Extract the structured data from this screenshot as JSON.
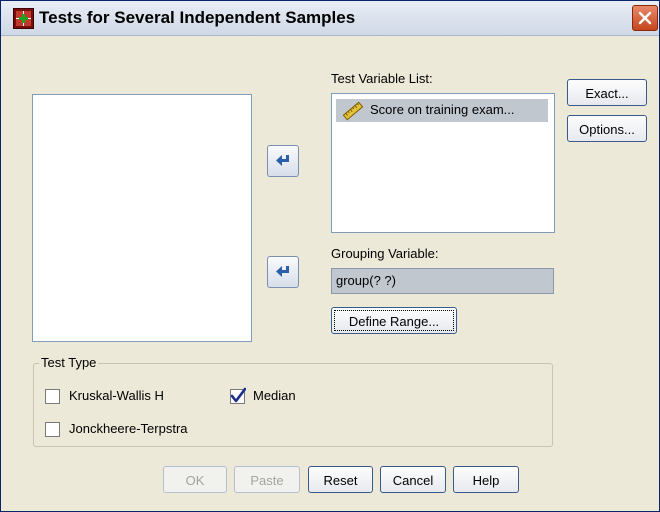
{
  "window": {
    "title": "Tests for Several Independent Samples"
  },
  "test_variable_list": {
    "label": "Test Variable List:",
    "items": [
      {
        "text": "Score on training exam..."
      }
    ]
  },
  "grouping_variable": {
    "label": "Grouping Variable:",
    "value": "group(? ?)"
  },
  "buttons": {
    "define_range": "Define Range...",
    "exact": "Exact...",
    "options": "Options...",
    "ok": "OK",
    "paste": "Paste",
    "reset": "Reset",
    "cancel": "Cancel",
    "help": "Help"
  },
  "test_type": {
    "title": "Test Type",
    "options": [
      {
        "label": "Kruskal-Wallis H",
        "checked": false
      },
      {
        "label": "Median",
        "checked": true
      },
      {
        "label": "Jonckheere-Terpstra",
        "checked": false
      }
    ]
  },
  "colors": {
    "dialog_bg": "#ece9d8",
    "selected_item": "#c1c7cf",
    "arrow": "#2b5fa8"
  }
}
